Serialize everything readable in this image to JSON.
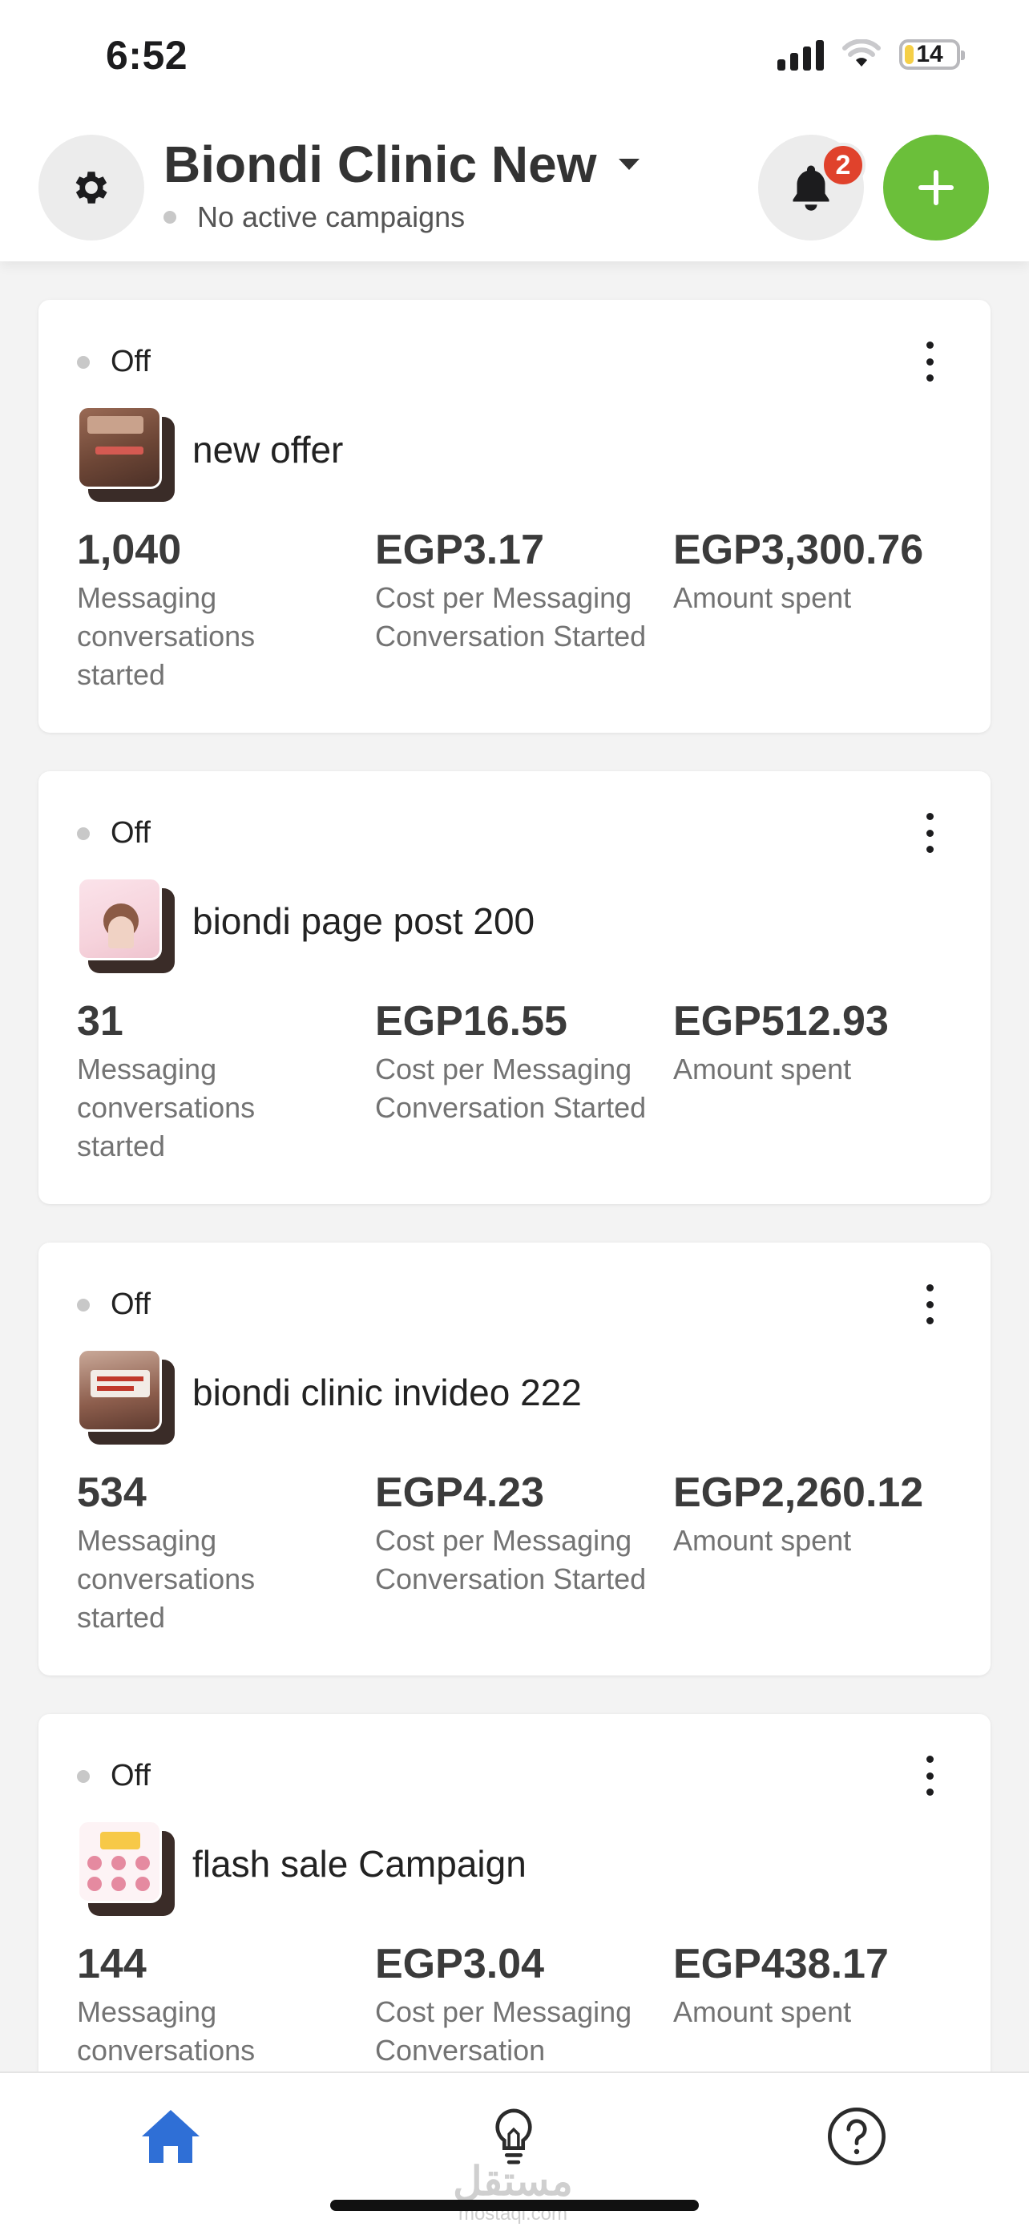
{
  "status_bar": {
    "time": "6:52",
    "battery": "14",
    "battery_level": 0.14,
    "battery_color": "#f5cf47"
  },
  "header": {
    "account_name": "Biondi Clinic New",
    "subtitle": "No active campaigns",
    "notification_count": "2",
    "icons": {
      "settings": "gear-icon",
      "notifications": "bell-icon",
      "add": "plus-icon",
      "dropdown": "caret-down-icon"
    },
    "colors": {
      "add_button": "#6bbf3a",
      "badge": "#e0422c"
    }
  },
  "campaigns": [
    {
      "status": "Off",
      "name": "new offer",
      "metrics": [
        {
          "value": "1,040",
          "label": "Messaging conversations started"
        },
        {
          "value": "EGP3.17",
          "label": "Cost per Messaging Conversation Started"
        },
        {
          "value": "EGP3,300.76",
          "label": "Amount spent"
        }
      ]
    },
    {
      "status": "Off",
      "name": "biondi page post 200",
      "metrics": [
        {
          "value": "31",
          "label": "Messaging conversations started"
        },
        {
          "value": "EGP16.55",
          "label": "Cost per Messaging Conversation Started"
        },
        {
          "value": "EGP512.93",
          "label": "Amount spent"
        }
      ]
    },
    {
      "status": "Off",
      "name": "biondi clinic invideo 222",
      "metrics": [
        {
          "value": "534",
          "label": "Messaging conversations started"
        },
        {
          "value": "EGP4.23",
          "label": "Cost per Messaging Conversation Started"
        },
        {
          "value": "EGP2,260.12",
          "label": "Amount spent"
        }
      ]
    },
    {
      "status": "Off",
      "name": "flash sale Campaign",
      "metrics": [
        {
          "value": "144",
          "label": "Messaging conversations"
        },
        {
          "value": "EGP3.04",
          "label": "Cost per Messaging Conversation"
        },
        {
          "value": "EGP438.17",
          "label": "Amount spent"
        }
      ]
    }
  ],
  "tab_bar": {
    "tabs": [
      {
        "icon": "home-icon",
        "active": true
      },
      {
        "icon": "lightbulb-icon",
        "active": false
      },
      {
        "icon": "help-icon",
        "active": false
      }
    ],
    "active_color": "#2f6fd6",
    "watermark_ar": "مستقل",
    "watermark_en": "mostaql.com"
  }
}
